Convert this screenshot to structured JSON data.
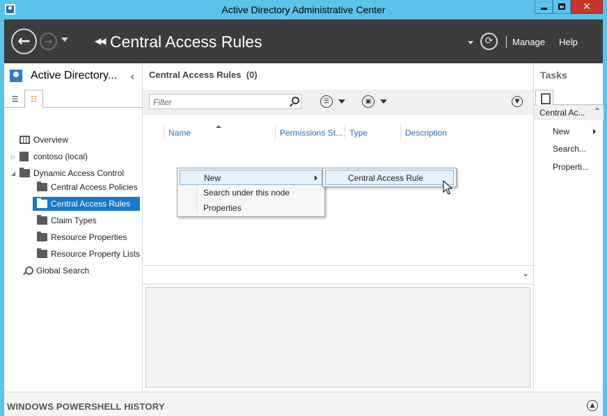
{
  "window": {
    "title": "Active Directory Administrative Center"
  },
  "header": {
    "breadcrumb_title": "Central Access Rules",
    "manage_label": "Manage",
    "help_label": "Help"
  },
  "leftnav": {
    "title": "Active Directory...",
    "items": [
      {
        "label": "Overview",
        "icon": "overview-icon"
      },
      {
        "label": "contoso (local)",
        "icon": "domain-icon"
      },
      {
        "label": "Dynamic Access Control",
        "icon": "folder-icon"
      },
      {
        "label": "Central Access Policies",
        "icon": "folder-icon"
      },
      {
        "label": "Central Access Rules",
        "icon": "folder-icon",
        "selected": true
      },
      {
        "label": "Claim Types",
        "icon": "folder-icon"
      },
      {
        "label": "Resource Properties",
        "icon": "folder-icon"
      },
      {
        "label": "Resource Property Lists",
        "icon": "folder-icon"
      },
      {
        "label": "Global Search",
        "icon": "search-icon"
      }
    ]
  },
  "center": {
    "title": "Central Access Rules",
    "count": "(0)",
    "filter_placeholder": "Filter",
    "columns": [
      "Name",
      "Permissions St...",
      "Type",
      "Description"
    ]
  },
  "context_menu": {
    "items": [
      "New",
      "Search under this node",
      "Properties"
    ],
    "submenu_item": "Central Access Rule"
  },
  "tasks": {
    "title": "Tasks",
    "group_label": "Central Ac...",
    "items": [
      "New",
      "Search...",
      "Properti..."
    ]
  },
  "powershell": {
    "label": "WINDOWS POWERSHELL HISTORY"
  },
  "colors": {
    "titlebar": "#5bc3ea",
    "header": "#3c3c3c",
    "selection": "#1979ca",
    "link": "#2b70b3",
    "close": "#c7362b"
  }
}
